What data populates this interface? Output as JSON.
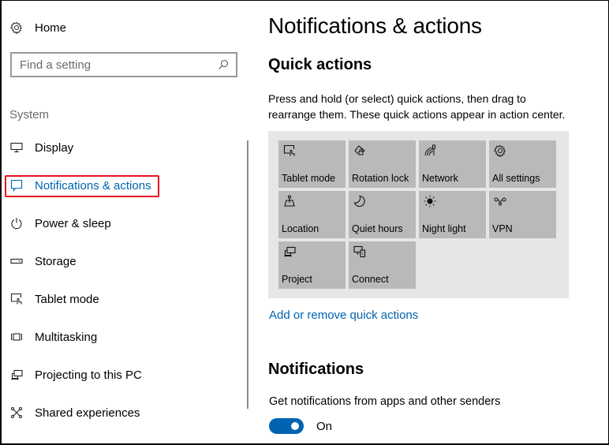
{
  "sidebar": {
    "home_label": "Home",
    "search": {
      "placeholder": "Find a setting",
      "value": ""
    },
    "section_label": "System",
    "items": [
      {
        "label": "Display",
        "icon": "display-icon",
        "active": false
      },
      {
        "label": "Notifications & actions",
        "icon": "notification-icon",
        "active": true
      },
      {
        "label": "Power & sleep",
        "icon": "power-icon",
        "active": false
      },
      {
        "label": "Storage",
        "icon": "storage-icon",
        "active": false
      },
      {
        "label": "Tablet mode",
        "icon": "tablet-mode-icon",
        "active": false
      },
      {
        "label": "Multitasking",
        "icon": "multitasking-icon",
        "active": false
      },
      {
        "label": "Projecting to this PC",
        "icon": "projecting-icon",
        "active": false
      },
      {
        "label": "Shared experiences",
        "icon": "shared-experiences-icon",
        "active": false
      }
    ]
  },
  "main": {
    "title": "Notifications & actions",
    "quick_actions": {
      "heading": "Quick actions",
      "description": "Press and hold (or select) quick actions, then drag to rearrange them. These quick actions appear in action center.",
      "tiles": [
        {
          "label": "Tablet mode",
          "icon": "tablet-mode-icon"
        },
        {
          "label": "Rotation lock",
          "icon": "rotation-lock-icon"
        },
        {
          "label": "Network",
          "icon": "network-icon"
        },
        {
          "label": "All settings",
          "icon": "gear-icon"
        },
        {
          "label": "Location",
          "icon": "location-icon"
        },
        {
          "label": "Quiet hours",
          "icon": "moon-icon"
        },
        {
          "label": "Night light",
          "icon": "night-light-icon"
        },
        {
          "label": "VPN",
          "icon": "vpn-icon"
        },
        {
          "label": "Project",
          "icon": "project-icon"
        },
        {
          "label": "Connect",
          "icon": "connect-icon"
        }
      ],
      "link": "Add or remove quick actions"
    },
    "notifications": {
      "heading": "Notifications",
      "setting_label": "Get notifications from apps and other senders",
      "toggle_on": true,
      "toggle_state": "On"
    }
  },
  "colors": {
    "accent": "#0063b1",
    "highlight_box": "#e81123",
    "tile_bg": "#b9b9b9",
    "panel_bg": "#e6e6e6"
  }
}
